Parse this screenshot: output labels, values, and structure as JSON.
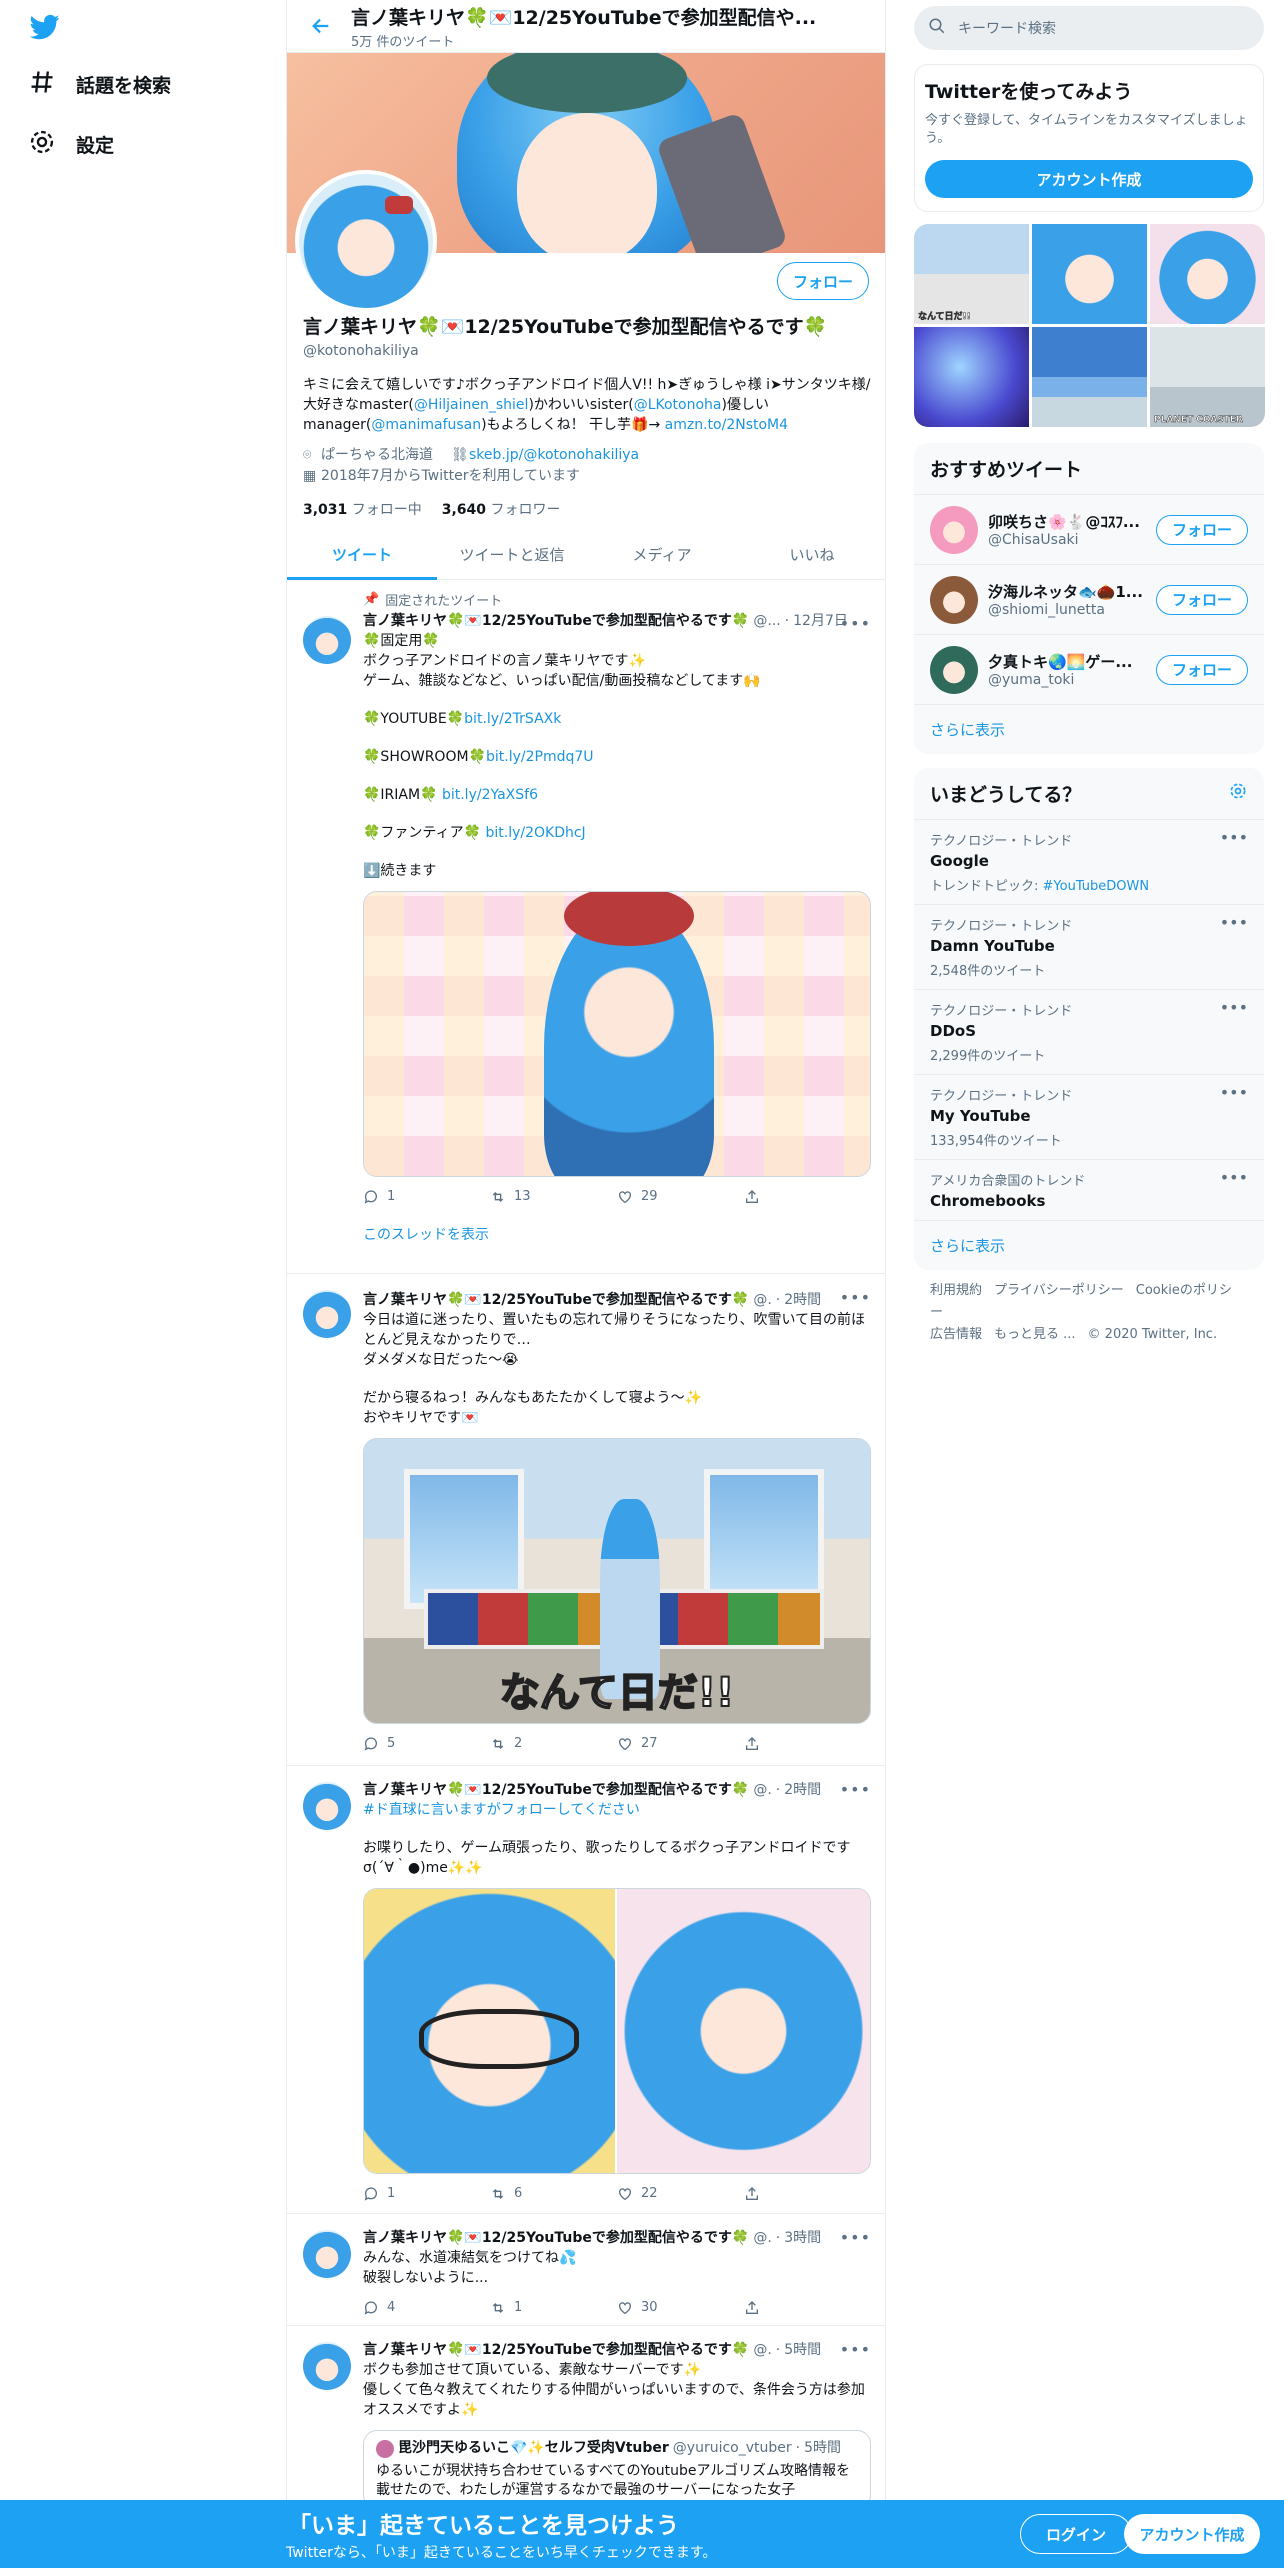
{
  "nav": {
    "explore_label": "話題を検索",
    "settings_label": "設定"
  },
  "header": {
    "title": "言ノ葉キリヤ🍀💌12/25YouTubeで参加型配信や...",
    "tweet_count": "5万 件のツイート"
  },
  "profile": {
    "name": "言ノ葉キリヤ🍀💌12/25YouTubeで参加型配信やるです🍀",
    "handle": "@kotonohakiliya",
    "follow_label": "フォロー",
    "bio_1": "キミに会えて嬉しいです♪ボクっ子アンドロイド個人V!! h➤ぎゅうしゃ様 i➤サンタツキ様/ 大好きなmaster(",
    "bio_link1": "@Hiljainen_shiel",
    "bio_2": ")かわいいsister(",
    "bio_link2": "@LKotonoha",
    "bio_3": ")優しいmanager(",
    "bio_link3": "@manimafusan",
    "bio_4": ")もよろしくね！ 干し芋🎁→ ",
    "bio_link4": "amzn.to/2NstoM4",
    "location": "ぱーちゃる北海道",
    "website": "skeb.jp/@kotonohakiliya",
    "joined": "2018年7月からTwitterを利用しています",
    "following_count": "3,031",
    "following_label": "フォロー中",
    "followers_count": "3,640",
    "followers_label": "フォロワー"
  },
  "tabs": [
    {
      "label": "ツイート",
      "active": true
    },
    {
      "label": "ツイートと返信",
      "active": false
    },
    {
      "label": "メディア",
      "active": false
    },
    {
      "label": "いいね",
      "active": false
    }
  ],
  "tweets": [
    {
      "pinned_label": "固定されたツイート",
      "name": "言ノ葉キリヤ🍀💌12/25YouTubeで参加型配信やるです🍀",
      "handle": "@...",
      "time": "12月7日",
      "text_lines": [
        "🍀固定用🍀",
        "ボクっ子アンドロイドの言ノ葉キリヤです✨",
        "ゲーム、雑談などなど、いっぱい配信/動画投稿などしてます🙌"
      ],
      "links": [
        {
          "prefix": "🍀YOUTUBE🍀",
          "url": "bit.ly/2TrSAXk"
        },
        {
          "prefix": "🍀SHOWROOM🍀",
          "url": "bit.ly/2Pmdq7U"
        },
        {
          "prefix": "🍀IRIAM🍀 ",
          "url": "bit.ly/2YaXSf6"
        },
        {
          "prefix": "🍀ファンティア🍀 ",
          "url": "bit.ly/2OKDhcJ"
        }
      ],
      "continue_text": "⬇️続きます",
      "replies": "1",
      "retweets": "13",
      "likes": "29",
      "thread_link": "このスレッドを表示"
    },
    {
      "name": "言ノ葉キリヤ🍀💌12/25YouTubeで参加型配信やるです🍀",
      "handle": "@.",
      "time": "2時間",
      "text_1": "今日は道に迷ったり、置いたもの忘れて帰りそうになったり、吹雪いて目の前ほとんど見えなかったりで…",
      "text_2": "ダメダメな日だった～😭",
      "text_3": "だから寝るねっ！みんなもあたたかくして寝よう～✨",
      "text_4": "おやキリヤです💌",
      "image_caption": "なんて日だ!!",
      "replies": "5",
      "retweets": "2",
      "likes": "27"
    },
    {
      "name": "言ノ葉キリヤ🍀💌12/25YouTubeで参加型配信やるです🍀",
      "handle": "@.",
      "time": "2時間",
      "hashtag": "#ド直球に言いますがフォローしてください",
      "text_1": "お喋りしたり、ゲーム頑張ったり、歌ったりしてるボクっ子アンドロイドですσ(´∀｀●)me✨✨",
      "replies": "1",
      "retweets": "6",
      "likes": "22"
    },
    {
      "name": "言ノ葉キリヤ🍀💌12/25YouTubeで参加型配信やるです🍀",
      "handle": "@.",
      "time": "3時間",
      "text_1": "みんな、水道凍結気をつけてね💦",
      "text_2": "破裂しないように...",
      "replies": "4",
      "retweets": "1",
      "likes": "30"
    },
    {
      "name": "言ノ葉キリヤ🍀💌12/25YouTubeで参加型配信やるです🍀",
      "handle": "@.",
      "time": "5時間",
      "text_1": "ボクも参加させて頂いている、素敵なサーバーです✨",
      "text_2": "優しくて色々教えてくれたりする仲間がいっぱいいますので、条件会う方は参加オススメですよ✨",
      "quote_name": "毘沙門天ゆるいこ💎✨セルフ受肉Vtuber",
      "quote_handle": "@yuruico_vtuber",
      "quote_time": "5時間",
      "quote_text": "ゆるいこが現状持ち合わせているすべてのYoutubeアルゴリズム攻略情報を載せたので、わたしが運営するなかで最強のサーバーになった女子"
    }
  ],
  "right": {
    "search_placeholder": "キーワード検索",
    "signup_title": "Twitterを使ってみよう",
    "signup_text": "今すぐ登録して、タイムラインをカスタマイズしましょう。",
    "signup_button": "アカウント作成",
    "thumb_label_1": "なんて日だ!!",
    "thumb_label_6": "PLANET COASTER",
    "recommend_title": "おすすめツイート",
    "recommend": [
      {
        "name": "卯咲ちさ🌸🐇@ｺｽﾌ...",
        "handle": "@ChisaUsaki",
        "follow": "フォロー"
      },
      {
        "name": "汐海ルネッタ🐟🌰1...",
        "handle": "@shiomi_lunetta",
        "follow": "フォロー"
      },
      {
        "name": "夕真トキ🌏🌅ゲー...",
        "handle": "@yuma_toki",
        "follow": "フォロー"
      }
    ],
    "show_more": "さらに表示",
    "trends_title": "いまどうしてる？",
    "trends": [
      {
        "category": "テクノロジー・トレンド",
        "name": "Google",
        "sub_prefix": "トレンドトピック: ",
        "sub_link": "#YouTubeDOWN"
      },
      {
        "category": "テクノロジー・トレンド",
        "name": "Damn YouTube",
        "sub": "2,548件のツイート"
      },
      {
        "category": "テクノロジー・トレンド",
        "name": "DDoS",
        "sub": "2,299件のツイート"
      },
      {
        "category": "テクノロジー・トレンド",
        "name": "My YouTube",
        "sub": "133,954件のツイート"
      },
      {
        "category": "アメリカ合衆国のトレンド",
        "name": "Chromebooks"
      }
    ],
    "trends_more": "さらに表示",
    "footer": [
      "利用規約",
      "プライバシーポリシー",
      "Cookieのポリシー",
      "広告情報",
      "もっと見る ...",
      "© 2020 Twitter, Inc."
    ]
  },
  "bottom_bar": {
    "headline": "「いま」起きていることを見つけよう",
    "subtext": "Twitterなら、「いま」起きていることをいち早くチェックできます。",
    "login": "ログイン",
    "signup": "アカウント作成"
  },
  "colors": {
    "accent": "#1da1f2",
    "link": "#1b95e0",
    "text_secondary": "#5b7083"
  }
}
